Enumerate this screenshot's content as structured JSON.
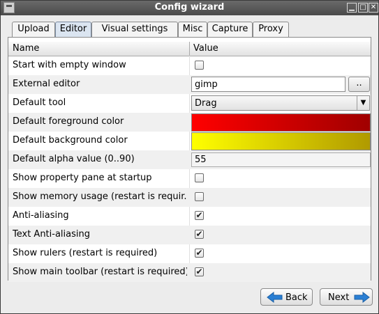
{
  "window": {
    "title": "Config wizard"
  },
  "tabs": [
    {
      "label": "Upload",
      "active": false
    },
    {
      "label": "Editor",
      "active": true
    },
    {
      "label": "Visual settings",
      "active": false
    },
    {
      "label": "Misc",
      "active": false
    },
    {
      "label": "Capture",
      "active": false
    },
    {
      "label": "Proxy",
      "active": false
    }
  ],
  "table": {
    "headers": [
      "Name",
      "Value"
    ],
    "rows": [
      {
        "name": "Start with empty window",
        "type": "checkbox",
        "checked": false
      },
      {
        "name": "External editor",
        "type": "text",
        "value": "gimp",
        "button": ".."
      },
      {
        "name": "Default tool",
        "type": "combo",
        "value": "Drag"
      },
      {
        "name": "Default foreground color",
        "type": "color",
        "color": "#ff0000"
      },
      {
        "name": "Default background color",
        "type": "color",
        "color": "#ffff00"
      },
      {
        "name": "Default alpha value (0..90)",
        "type": "number",
        "value": "55"
      },
      {
        "name": "Show property pane at startup",
        "type": "checkbox",
        "checked": false
      },
      {
        "name": "Show memory usage (restart is requir...",
        "type": "checkbox",
        "checked": false
      },
      {
        "name": "Anti-aliasing",
        "type": "checkbox",
        "checked": true
      },
      {
        "name": "Text Anti-aliasing",
        "type": "checkbox",
        "checked": true
      },
      {
        "name": "Show rulers (restart is required)",
        "type": "checkbox",
        "checked": true
      },
      {
        "name": "Show main toolbar (restart is required)",
        "type": "checkbox",
        "checked": true
      }
    ]
  },
  "buttons": {
    "back": "Back",
    "next": "Next"
  },
  "icons": {
    "back": "arrow-left-icon",
    "next": "arrow-right-icon"
  },
  "colors": {
    "accent_arrow": "#2a7fd4",
    "titlebar": "#555555"
  }
}
